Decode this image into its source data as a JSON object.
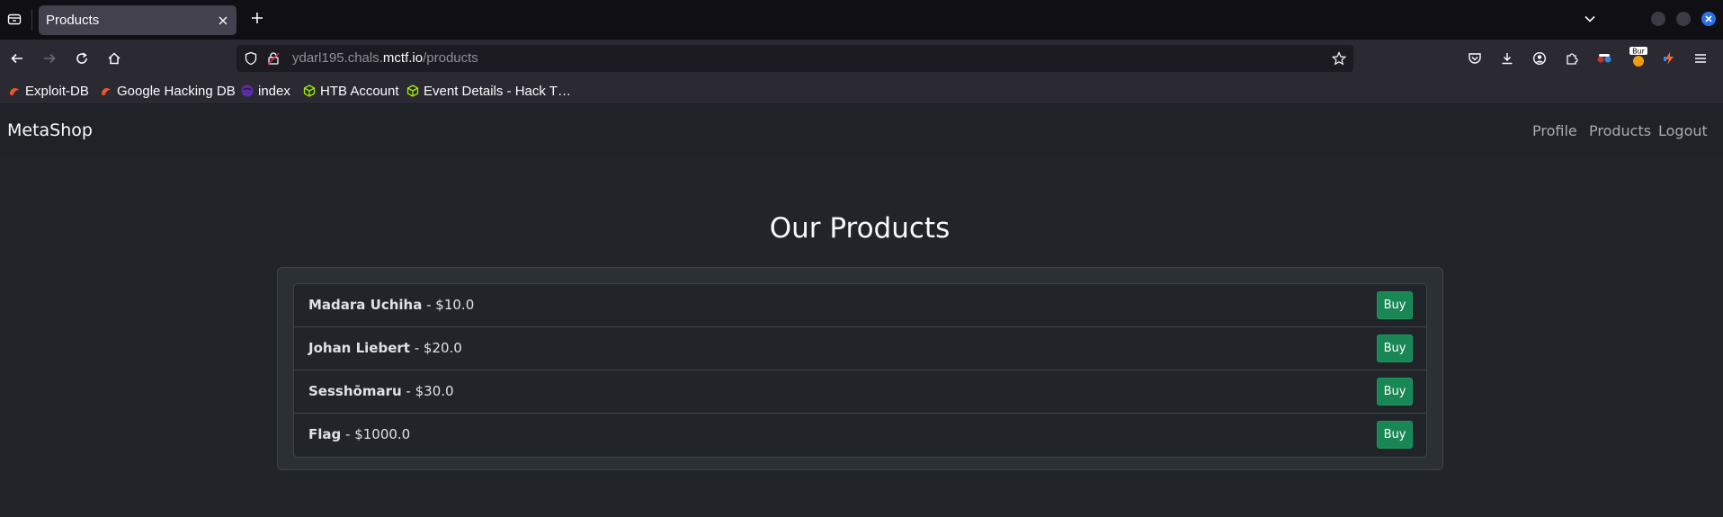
{
  "browser": {
    "tab": {
      "title": "Products"
    },
    "url": {
      "prefix": "ydarl195.chals.",
      "host": "mctf.io",
      "path": "/products"
    },
    "bookmarks": [
      {
        "label": "Exploit-DB",
        "icon": "exploit-db-icon",
        "color": "#e8572a"
      },
      {
        "label": "Google Hacking DB",
        "icon": "ghdb-icon",
        "color": "#e8572a"
      },
      {
        "label": "index",
        "icon": "index-icon",
        "color": "#5b2ea6"
      },
      {
        "label": "HTB Account",
        "icon": "htb-cube-icon",
        "color": "#9fef00"
      },
      {
        "label": "Event Details - Hack T…",
        "icon": "htb-cube-icon",
        "color": "#9fef00"
      }
    ],
    "extension_badge": "Bur"
  },
  "site": {
    "brand": "MetaShop",
    "nav": {
      "profile": "Profile",
      "products": "Products",
      "logout": "Logout"
    },
    "heading": "Our Products",
    "products": [
      {
        "name": "Madara Uchiha",
        "price": " - $10.0",
        "buy": "Buy"
      },
      {
        "name": "Johan Liebert",
        "price": " - $20.0",
        "buy": "Buy"
      },
      {
        "name": "Sesshōmaru",
        "price": " - $30.0",
        "buy": "Buy"
      },
      {
        "name": "Flag",
        "price": " - $1000.0",
        "buy": "Buy"
      }
    ]
  },
  "colors": {
    "buy_button": "#198754",
    "page_background": "#212529",
    "browser_chrome": "#2b2a33"
  }
}
